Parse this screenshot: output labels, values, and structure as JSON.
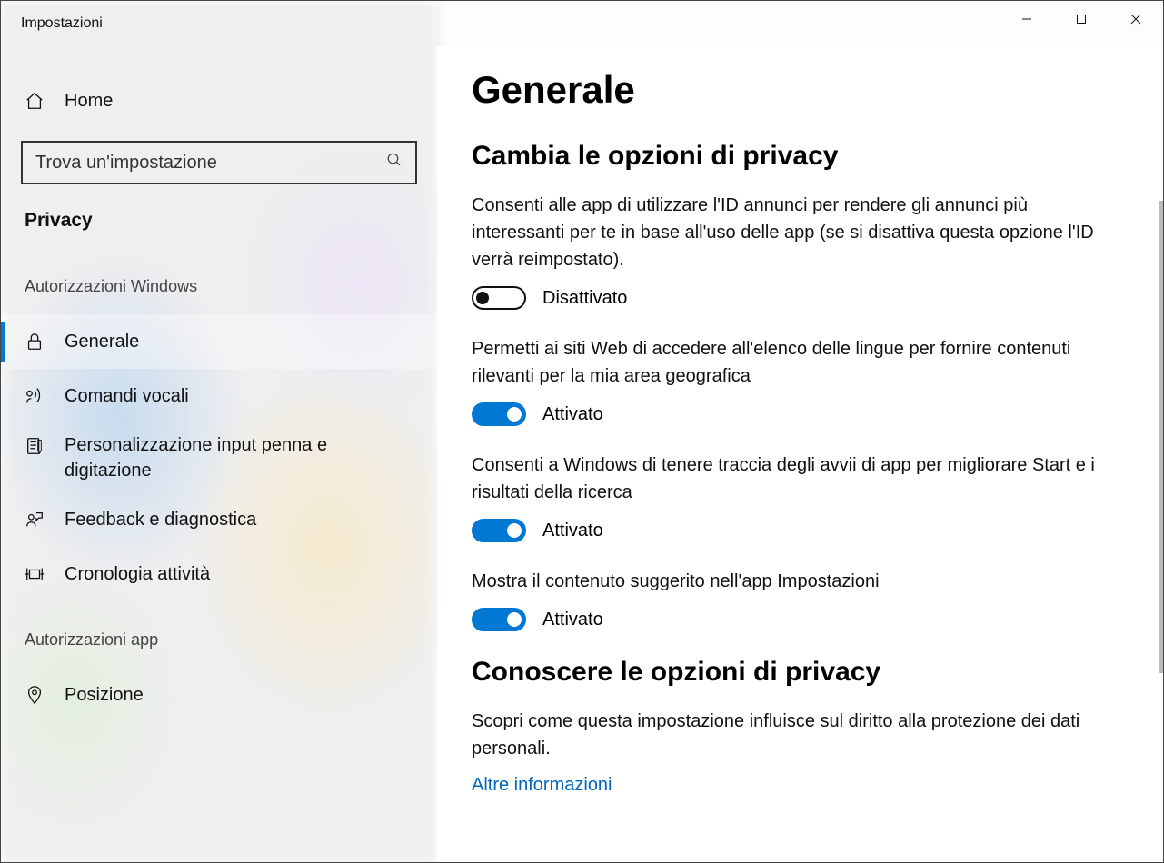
{
  "window": {
    "title": "Impostazioni"
  },
  "sidebar": {
    "home_label": "Home",
    "search_placeholder": "Trova un'impostazione",
    "section_label": "Privacy",
    "group1_title": "Autorizzazioni Windows",
    "group1_items": [
      {
        "label": "Generale"
      },
      {
        "label": "Comandi vocali"
      },
      {
        "label": "Personalizzazione input penna e digitazione"
      },
      {
        "label": "Feedback e diagnostica"
      },
      {
        "label": "Cronologia attività"
      }
    ],
    "group2_title": "Autorizzazioni app",
    "group2_items": [
      {
        "label": "Posizione"
      }
    ]
  },
  "content": {
    "page_title": "Generale",
    "section1_title": "Cambia le opzioni di privacy",
    "settings": [
      {
        "desc": "Consenti alle app di utilizzare l'ID annunci per rendere gli annunci più interessanti per te in base all'uso delle app (se si disattiva questa opzione l'ID verrà reimpostato).",
        "on": false,
        "state_label": "Disattivato"
      },
      {
        "desc": "Permetti ai siti Web di accedere all'elenco delle lingue per fornire contenuti rilevanti per la mia area geografica",
        "on": true,
        "state_label": "Attivato"
      },
      {
        "desc": "Consenti a Windows di tenere traccia degli avvii di app per migliorare Start e i risultati della ricerca",
        "on": true,
        "state_label": "Attivato"
      },
      {
        "desc": "Mostra il contenuto suggerito nell'app Impostazioni",
        "on": true,
        "state_label": "Attivato"
      }
    ],
    "section2_title": "Conoscere le opzioni di privacy",
    "section2_desc": "Scopri come questa impostazione influisce sul diritto alla protezione dei dati personali.",
    "section2_link": "Altre informazioni"
  }
}
